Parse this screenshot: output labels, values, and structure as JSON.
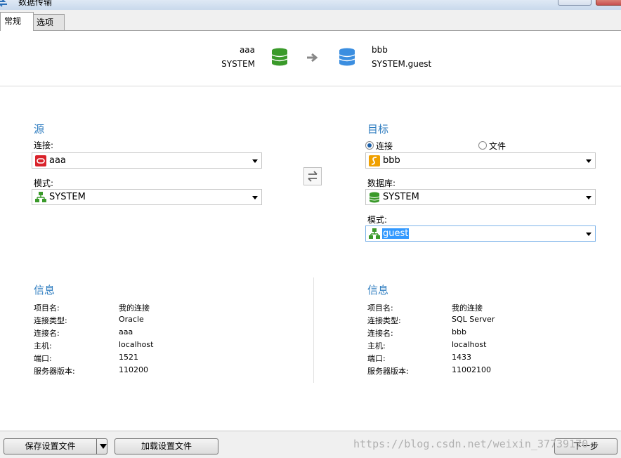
{
  "window": {
    "title": "数据传输"
  },
  "tabs": [
    {
      "label": "常规"
    },
    {
      "label": "选项"
    }
  ],
  "header": {
    "source_name": "aaa",
    "source_schema": "SYSTEM",
    "target_name": "bbb",
    "target_schema": "SYSTEM.guest"
  },
  "source": {
    "title": "源",
    "connection_label": "连接:",
    "connection_value": "aaa",
    "schema_label": "模式:",
    "schema_value": "SYSTEM"
  },
  "target": {
    "title": "目标",
    "radio_connection": "连接",
    "radio_file": "文件",
    "connection_value": "bbb",
    "database_label": "数据库:",
    "database_value": "SYSTEM",
    "schema_label": "模式:",
    "schema_value": "guest"
  },
  "source_info": {
    "title": "信息",
    "rows": [
      {
        "k": "项目名:",
        "v": "我的连接"
      },
      {
        "k": "连接类型:",
        "v": "Oracle"
      },
      {
        "k": "连接名:",
        "v": "aaa"
      },
      {
        "k": "主机:",
        "v": "localhost"
      },
      {
        "k": "端口:",
        "v": "1521"
      },
      {
        "k": "服务器版本:",
        "v": "110200"
      }
    ]
  },
  "target_info": {
    "title": "信息",
    "rows": [
      {
        "k": "项目名:",
        "v": "我的连接"
      },
      {
        "k": "连接类型:",
        "v": "SQL Server"
      },
      {
        "k": "连接名:",
        "v": "bbb"
      },
      {
        "k": "主机:",
        "v": "localhost"
      },
      {
        "k": "端口:",
        "v": "1433"
      },
      {
        "k": "服务器版本:",
        "v": "11002100"
      }
    ]
  },
  "footer": {
    "save_label": "保存设置文件",
    "load_label": "加载设置文件",
    "next_label": "下一步"
  },
  "watermark": "https://blog.csdn.net/weixin_37739170",
  "colors": {
    "accent": "#2f7dc0",
    "source_db": "#3a9a2a",
    "target_db": "#3b8ee0",
    "oracle": "#d9222a",
    "sqlserver": "#f0a000"
  }
}
